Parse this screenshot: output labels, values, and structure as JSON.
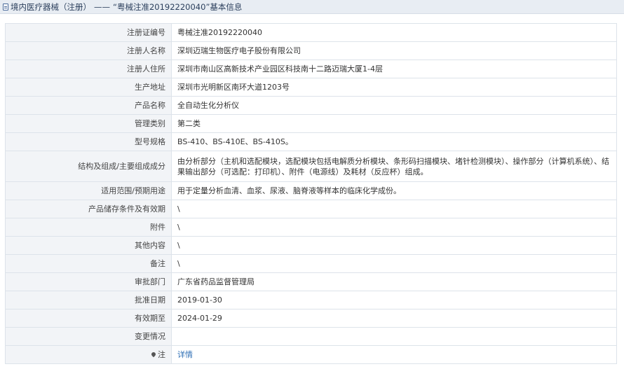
{
  "header": {
    "category": "境内医疗器械（注册）",
    "separator": "——",
    "title": "“粤械注准20192220040”基本信息"
  },
  "rows": [
    {
      "label": "注册证编号",
      "value": "粤械注准20192220040"
    },
    {
      "label": "注册人名称",
      "value": "深圳迈瑞生物医疗电子股份有限公司"
    },
    {
      "label": "注册人住所",
      "value": "深圳市南山区高新技术产业园区科技南十二路迈瑞大厦1-4层"
    },
    {
      "label": "生产地址",
      "value": "深圳市光明新区南环大道1203号"
    },
    {
      "label": "产品名称",
      "value": "全自动生化分析仪"
    },
    {
      "label": "管理类别",
      "value": "第二类"
    },
    {
      "label": "型号规格",
      "value": "BS-410、BS-410E、BS-410S。"
    },
    {
      "label": "结构及组成/主要组成成分",
      "value": "由分析部分（主机和选配模块，选配模块包括电解质分析模块、条形码扫描模块、堵针检测模块）、操作部分（计算机系统）、结果输出部分（可选配：打印机）、附件（电源线）及耗材（反应杯）组成。"
    },
    {
      "label": "适用范围/预期用途",
      "value": "用于定量分析血清、血浆、尿液、脑脊液等样本的临床化学成份。"
    },
    {
      "label": "产品储存条件及有效期",
      "value": "\\"
    },
    {
      "label": "附件",
      "value": "\\"
    },
    {
      "label": "其他内容",
      "value": "\\"
    },
    {
      "label": "备注",
      "value": "\\"
    },
    {
      "label": "审批部门",
      "value": "广东省药品监督管理局"
    },
    {
      "label": "批准日期",
      "value": "2019-01-30"
    },
    {
      "label": "有效期至",
      "value": "2024-01-29"
    },
    {
      "label": "变更情况",
      "value": ""
    },
    {
      "label": "注",
      "value": "详情"
    }
  ],
  "icons": {
    "header": "document-icon",
    "note": "pin-icon"
  },
  "colors": {
    "link": "#2f6fb5",
    "label_bg": "#f2f4f7",
    "header_bg": "#e8edf3"
  }
}
